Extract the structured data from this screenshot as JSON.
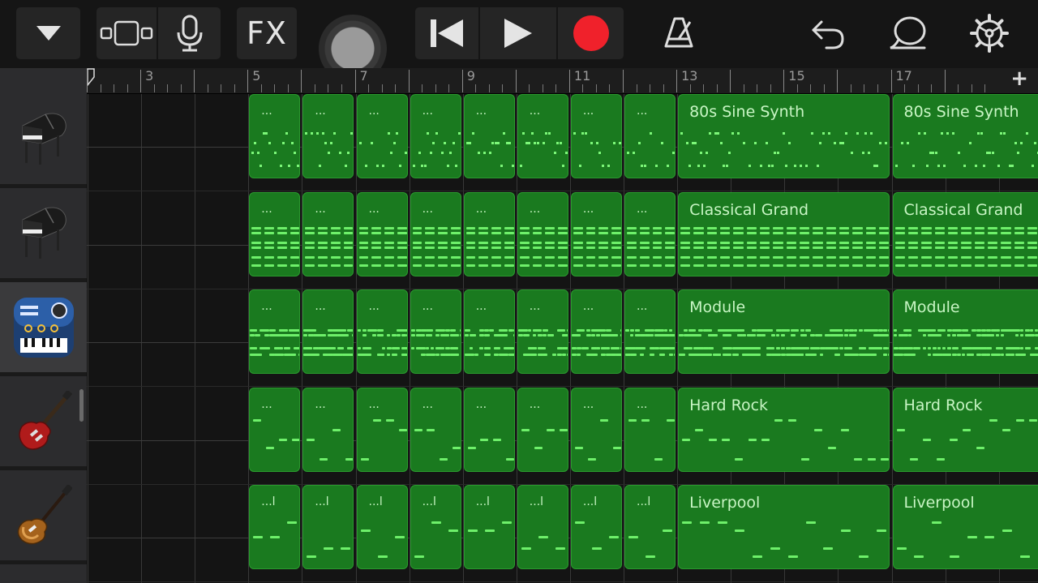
{
  "toolbar": {
    "fx_label": "FX",
    "icons": [
      "dropdown-triangle-icon",
      "tracks-view-icon",
      "microphone-icon",
      "skip-to-start-icon",
      "play-icon",
      "record-icon",
      "metronome-icon",
      "undo-icon",
      "loop-icon",
      "settings-gear-icon"
    ],
    "record_color": "#f0212b"
  },
  "ruler": {
    "bar_labels": [
      "3",
      "5",
      "7",
      "9",
      "11",
      "13",
      "15",
      "17"
    ],
    "add_label": "+"
  },
  "tracks": [
    {
      "instrument": "grand-piano-icon",
      "region_name": "80s Sine Synth",
      "short_label": "...",
      "pattern": "dots"
    },
    {
      "instrument": "grand-piano-icon",
      "region_name": "Classical Grand",
      "short_label": "...",
      "pattern": "chords"
    },
    {
      "instrument": "synth-module-icon",
      "region_name": "Module",
      "short_label": "...",
      "pattern": "dashes"
    },
    {
      "instrument": "electric-guitar-icon",
      "region_name": "Hard Rock",
      "short_label": "...",
      "pattern": "riff"
    },
    {
      "instrument": "bass-guitar-icon",
      "region_name": "Liverpool",
      "short_label": "...l",
      "pattern": "bass"
    }
  ],
  "colors": {
    "region_fill": "#1a7a1f",
    "note": "#6ef06a",
    "background": "#141414"
  }
}
